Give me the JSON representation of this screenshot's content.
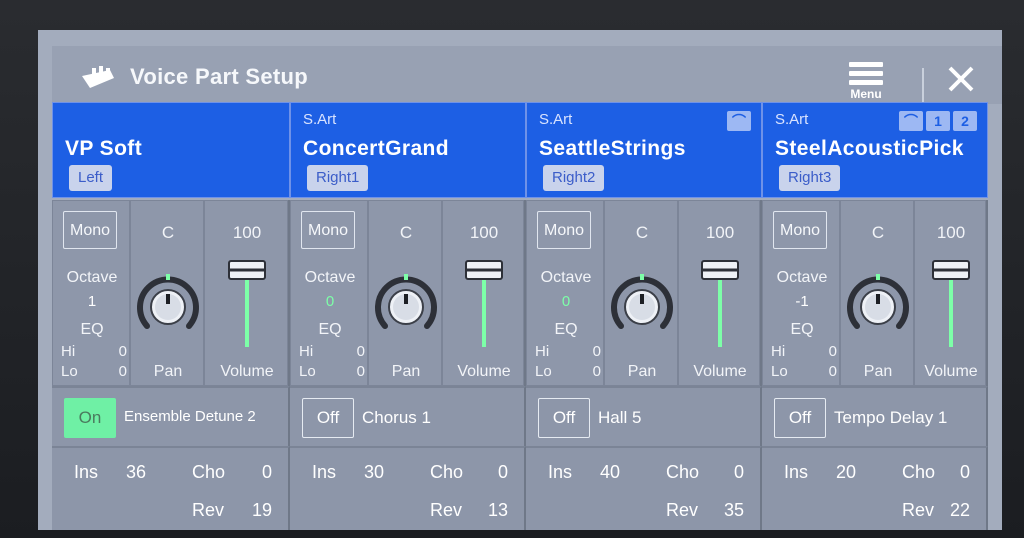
{
  "title": "Voice Part Setup",
  "menu_label": "Menu",
  "icons": {
    "app": "keyboard-icon",
    "menu": "hamburger-menu-icon",
    "close": "close-icon"
  },
  "colors": {
    "part_header": "#1d5fe4",
    "effect_on": "#6ff0a5",
    "octave_zero": "#7dffa8"
  },
  "parts": [
    {
      "art": "",
      "name": "VP Soft",
      "tag": "Left",
      "art_icons": [],
      "mono": "Mono",
      "octave_label": "Octave",
      "octave": "1",
      "eq_label": "EQ",
      "hi_label": "Hi",
      "hi": "0",
      "lo_label": "Lo",
      "lo": "0",
      "pan": "C",
      "pan_label": "Pan",
      "volume": "100",
      "volume_label": "Volume",
      "effect_state": "On",
      "effect_name": "Ensemble Detune 2",
      "ins_label": "Ins",
      "ins": "36",
      "cho_label": "Cho",
      "cho": "0",
      "rev_label": "Rev",
      "rev": "19"
    },
    {
      "art": "S.Art",
      "name": "ConcertGrand",
      "tag": "Right1",
      "art_icons": [],
      "mono": "Mono",
      "octave_label": "Octave",
      "octave": "0",
      "eq_label": "EQ",
      "hi_label": "Hi",
      "hi": "0",
      "lo_label": "Lo",
      "lo": "0",
      "pan": "C",
      "pan_label": "Pan",
      "volume": "100",
      "volume_label": "Volume",
      "effect_state": "Off",
      "effect_name": "Chorus 1",
      "ins_label": "Ins",
      "ins": "30",
      "cho_label": "Cho",
      "cho": "0",
      "rev_label": "Rev",
      "rev": "13"
    },
    {
      "art": "S.Art",
      "name": "SeattleStrings",
      "tag": "Right2",
      "art_icons": [
        "⌒"
      ],
      "mono": "Mono",
      "octave_label": "Octave",
      "octave": "0",
      "eq_label": "EQ",
      "hi_label": "Hi",
      "hi": "0",
      "lo_label": "Lo",
      "lo": "0",
      "pan": "C",
      "pan_label": "Pan",
      "volume": "100",
      "volume_label": "Volume",
      "effect_state": "Off",
      "effect_name": "Hall 5",
      "ins_label": "Ins",
      "ins": "40",
      "cho_label": "Cho",
      "cho": "0",
      "rev_label": "Rev",
      "rev": "35"
    },
    {
      "art": "S.Art",
      "name": "SteelAcousticPick",
      "tag": "Right3",
      "art_icons": [
        "⌒",
        "1",
        "2"
      ],
      "mono": "Mono",
      "octave_label": "Octave",
      "octave": "-1",
      "eq_label": "EQ",
      "hi_label": "Hi",
      "hi": "0",
      "lo_label": "Lo",
      "lo": "0",
      "pan": "C",
      "pan_label": "Pan",
      "volume": "100",
      "volume_label": "Volume",
      "effect_state": "Off",
      "effect_name": "Tempo Delay 1",
      "ins_label": "Ins",
      "ins": "20",
      "cho_label": "Cho",
      "cho": "0",
      "rev_label": "Rev",
      "rev": "22"
    }
  ]
}
